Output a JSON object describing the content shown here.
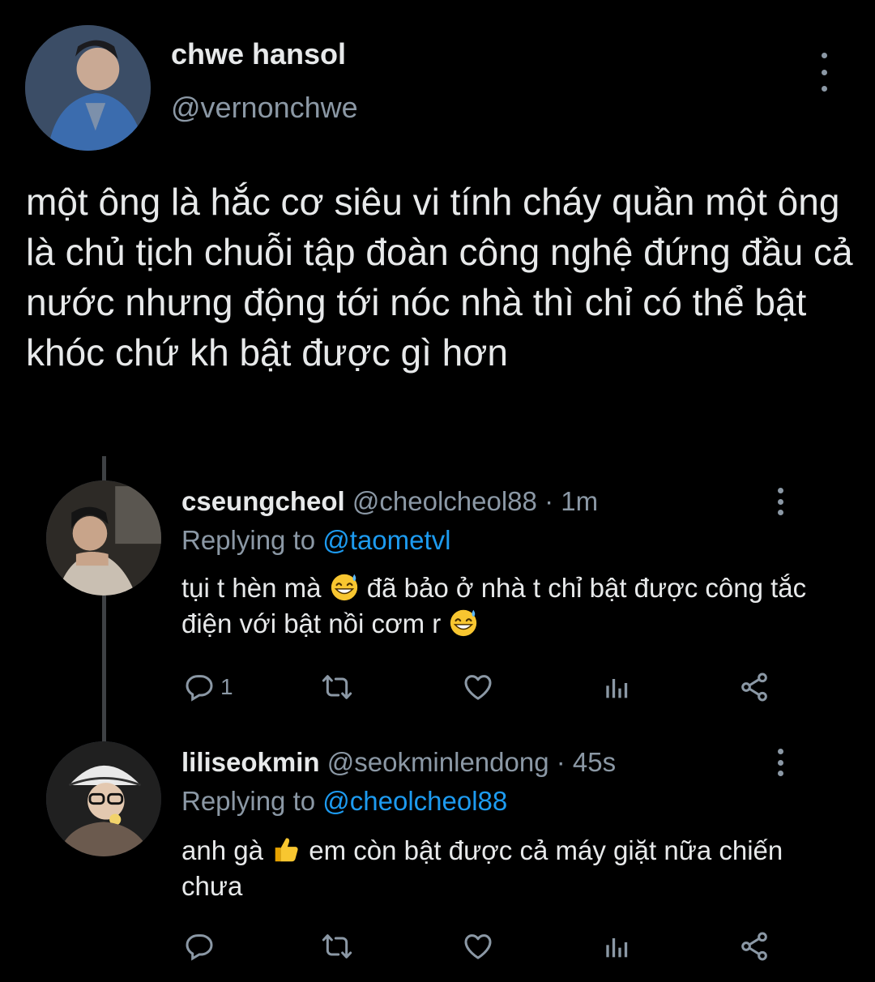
{
  "main_tweet": {
    "name": "chwe hansol",
    "handle": "@vernonchwe",
    "text": "một ông là hắc cơ siêu vi tính cháy quần một ông là chủ tịch chuỗi tập đoàn công nghệ đứng đầu cả nước nhưng động tới nóc nhà thì chỉ có thể bật khóc chứ kh bật được gì hơn"
  },
  "replies": [
    {
      "name": "cseungcheol",
      "handle": "@cheolcheol88",
      "separator": "·",
      "time": "1m",
      "replying_prefix": "Replying to",
      "replying_to": "@taometvl",
      "text_part1": "tụi t hèn mà",
      "text_part2": "đã bảo ở nhà t chỉ bật được công tắc điện với bật nồi cơm r",
      "emoji": "grinning-sweat",
      "reply_count": "1"
    },
    {
      "name": "liliseokmin",
      "handle": "@seokminlendong",
      "separator": "·",
      "time": "45s",
      "replying_prefix": "Replying to",
      "replying_to": "@cheolcheol88",
      "text_part1": "anh gà",
      "text_part2": "em còn bật được cả máy giặt nữa chiến chưa",
      "emoji": "thumbs-up",
      "reply_count": ""
    }
  ],
  "colors": {
    "background": "#000000",
    "text": "#e7e9ea",
    "muted": "#8b98a5",
    "link": "#1d9bf0",
    "thread_line": "#3e4144"
  }
}
